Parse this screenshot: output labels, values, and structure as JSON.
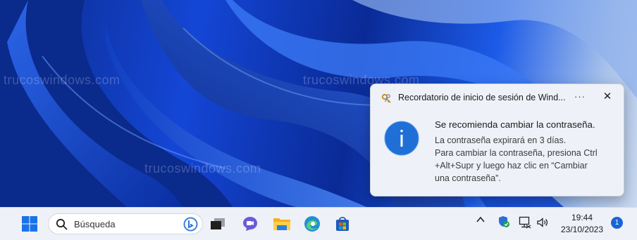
{
  "desktop": {
    "watermarks": [
      "trucoswindows.com",
      "trucoswindows.com",
      "trucoswindows.com"
    ]
  },
  "notification": {
    "app_name": "Recordatorio de inicio de sesión de Wind...",
    "more_label": "···",
    "close_label": "✕",
    "title": "Se recomienda cambiar la contraseña.",
    "body_lines": [
      "La contraseña expirará en 3 días.",
      "Para cambiar la contraseña, presiona Ctrl",
      "+Alt+Supr y luego haz clic en “Cambiar",
      "una contraseña”."
    ]
  },
  "taskbar": {
    "search_placeholder": "Búsqueda",
    "pinned_apps": [
      "start-button",
      "task-view",
      "teams-chat",
      "file-explorer",
      "edge",
      "microsoft-store"
    ],
    "tray": {
      "chevron_label": "^",
      "time": "19:44",
      "date": "23/10/2023",
      "notification_count": "1"
    }
  },
  "colors": {
    "accent": "#1764d8",
    "info_icon": "#1f6fd6",
    "taskbar_bg": "#eef1f7",
    "toast_bg": "#eef1f8"
  }
}
